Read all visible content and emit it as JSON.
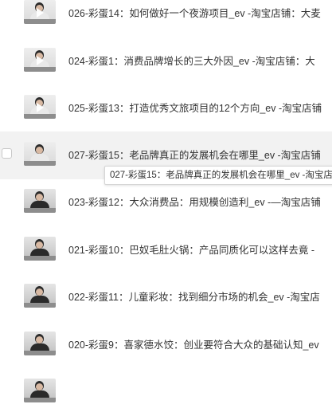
{
  "items": [
    {
      "title": "026-彩蛋14：如何做好一个夜游项目_ev -淘宝店铺：大麦",
      "thumb": "light"
    },
    {
      "title": "024-彩蛋1：消费品牌增长的三大外因_ev -淘宝店铺：大",
      "thumb": "light"
    },
    {
      "title": "025-彩蛋13：打造优秀文旅项目的12个方向_ev -淘宝店铺",
      "thumb": "light"
    },
    {
      "title": "027-彩蛋15：老品牌真正的发展机会在哪里_ev -淘宝店铺",
      "thumb": "light"
    },
    {
      "title": "023-彩蛋12：大众消费品：用规模创造利_ev -—淘宝店铺",
      "thumb": "dark"
    },
    {
      "title": "021-彩蛋10：巴奴毛肚火锅：产品同质化可以这样去竟 -",
      "thumb": "dark"
    },
    {
      "title": "022-彩蛋11：儿童彩妆：找到细分市场的机会_ev -淘宝店",
      "thumb": "dark"
    },
    {
      "title": "020-彩蛋9：喜家德水饺：创业要符合大众的基础认知_ev",
      "thumb": "dark"
    }
  ],
  "tooltip": "027-彩蛋15：老品牌真正的发展机会在哪里_ev -淘宝店"
}
